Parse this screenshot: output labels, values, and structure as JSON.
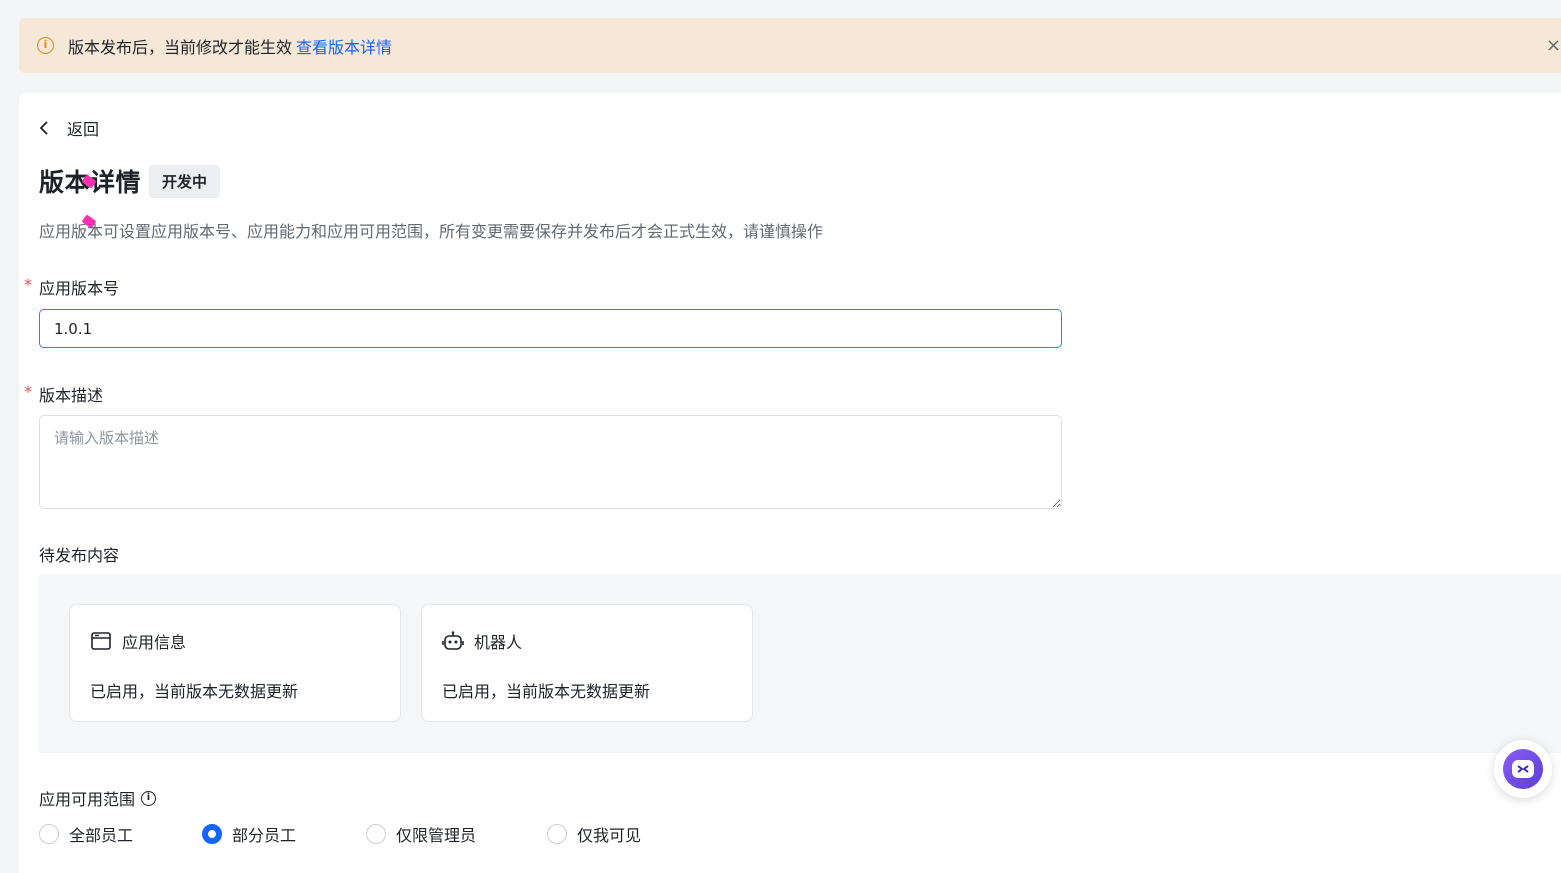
{
  "banner": {
    "message": "版本发布后，当前修改才能生效",
    "link": "查看版本详情",
    "close": "×"
  },
  "back": {
    "icon": "chevron-left-icon",
    "label": "返回"
  },
  "page": {
    "title": "版本详情",
    "status": "开发中",
    "description": "应用版本可设置应用版本号、应用能力和应用可用范围，所有变更需要保存并发布后才会正式生效，请谨慎操作"
  },
  "form": {
    "required_mark": "*",
    "version_label": "应用版本号",
    "version_value": "1.0.1",
    "desc_label": "版本描述",
    "desc_placeholder": "请输入版本描述"
  },
  "pending": {
    "label": "待发布内容",
    "items": [
      {
        "icon": "app-window-icon",
        "title": "应用信息",
        "status": "已启用，当前版本无数据更新"
      },
      {
        "icon": "robot-icon",
        "title": "机器人",
        "status": "已启用，当前版本无数据更新"
      }
    ]
  },
  "scope": {
    "label": "应用可用范围",
    "help_icon": "info-circle-icon",
    "options": [
      {
        "label": "全部员工",
        "selected": false
      },
      {
        "label": "部分员工",
        "selected": true
      },
      {
        "label": "仅限管理员",
        "selected": false
      },
      {
        "label": "仅我可见",
        "selected": false
      }
    ]
  },
  "colors": {
    "accent": "#1664ff",
    "banner_bg": "#f6e8d6",
    "warning": "#e88a1a",
    "required": "#f54a45",
    "input_focus_border": "#1e8fd2"
  }
}
